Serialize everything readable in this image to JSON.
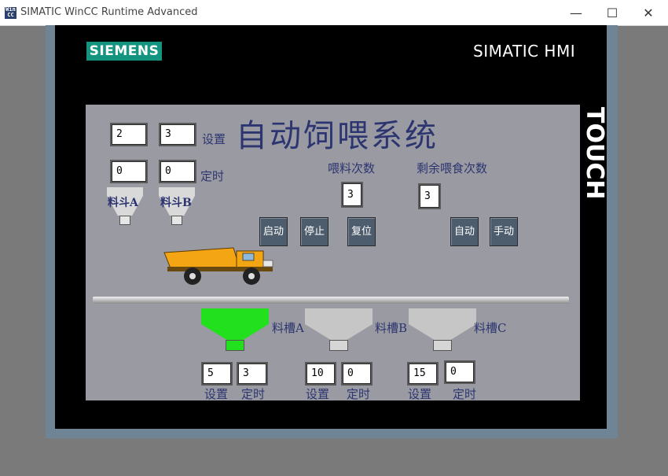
{
  "window": {
    "icon_text": "WinCC",
    "title": "SIMATIC WinCC Runtime Advanced",
    "min": "—",
    "max": "☐",
    "close": "✕"
  },
  "device": {
    "brand": "SIEMENS",
    "model": "SIMATIC HMI",
    "side_label": "TOUCH",
    "brand_color": "#14957f"
  },
  "screen": {
    "title": "自动饲喂系统",
    "hopper_a": {
      "setting": "2",
      "timer": "0",
      "label": "料斗A"
    },
    "hopper_b": {
      "setting": "3",
      "timer": "0",
      "label": "料斗B"
    },
    "setting_label": "设置",
    "timer_label": "定时",
    "feed_count": {
      "label": "喂料次数",
      "value": "3"
    },
    "remaining_count": {
      "label": "剩余喂食次数",
      "value": "3"
    },
    "buttons": {
      "start": "启动",
      "stop": "停止",
      "reset": "复位",
      "auto": "自动",
      "manual": "手动"
    },
    "troughs": [
      {
        "label": "料槽A",
        "setting": "5",
        "timer": "3",
        "color": "#22e01e"
      },
      {
        "label": "料槽B",
        "setting": "10",
        "timer": "0",
        "color": "#c6c6c6"
      },
      {
        "label": "料槽C",
        "setting": "15",
        "timer": "0",
        "color": "#c6c6c6"
      }
    ],
    "icons": {
      "truck": "dump-truck-icon"
    }
  }
}
